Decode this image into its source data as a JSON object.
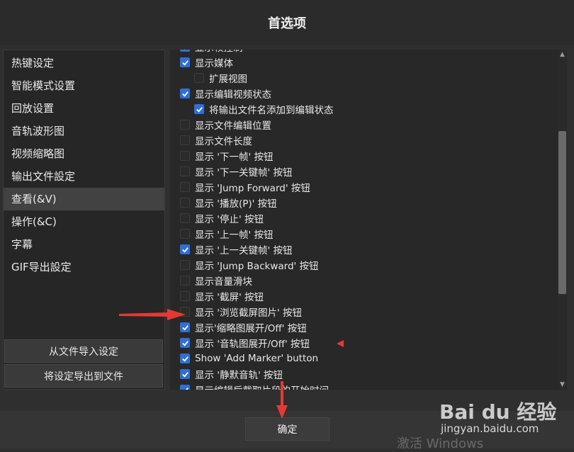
{
  "dialog": {
    "title": "首选项",
    "ok_label": "确定"
  },
  "nav": [
    {
      "label": "热键设定",
      "selected": false
    },
    {
      "label": "智能模式设置",
      "selected": false
    },
    {
      "label": "回放设置",
      "selected": false
    },
    {
      "label": "音轨波形图",
      "selected": false
    },
    {
      "label": "视频缩略图",
      "selected": false
    },
    {
      "label": "输出文件設定",
      "selected": false
    },
    {
      "label": "查看(&V)",
      "selected": true
    },
    {
      "label": "操作(&C)",
      "selected": false
    },
    {
      "label": "字幕",
      "selected": false
    },
    {
      "label": "GIF导出設定",
      "selected": false
    }
  ],
  "left_buttons": {
    "import": "从文件导入设定",
    "export": "将设定导出到文件"
  },
  "options": [
    {
      "label": "显示帧控制",
      "checked": true,
      "indent": false
    },
    {
      "label": "显示媒体",
      "checked": true,
      "indent": false
    },
    {
      "label": "扩展视图",
      "checked": false,
      "indent": true
    },
    {
      "label": "显示编辑视频状态",
      "checked": true,
      "indent": false
    },
    {
      "label": "将输出文件名添加到编辑状态",
      "checked": true,
      "indent": true
    },
    {
      "label": "显示文件编辑位置",
      "checked": false,
      "indent": false
    },
    {
      "label": "显示文件长度",
      "checked": false,
      "indent": false
    },
    {
      "label": "显示 '下一帧' 按钮",
      "checked": false,
      "indent": false
    },
    {
      "label": "显示 '下一关键帧' 按钮",
      "checked": false,
      "indent": false
    },
    {
      "label": "显示 'Jump Forward' 按钮",
      "checked": false,
      "indent": false
    },
    {
      "label": "显示 '播放(P)' 按钮",
      "checked": false,
      "indent": false
    },
    {
      "label": "显示 '停止' 按钮",
      "checked": false,
      "indent": false
    },
    {
      "label": "显示 '上一帧' 按钮",
      "checked": false,
      "indent": false
    },
    {
      "label": "显示 '上一关键帧' 按钮",
      "checked": true,
      "indent": false
    },
    {
      "label": "显示 'Jump Backward' 按钮",
      "checked": false,
      "indent": false
    },
    {
      "label": "显示音量滑块",
      "checked": false,
      "indent": false
    },
    {
      "label": "显示 '截屏' 按钮",
      "checked": false,
      "indent": false
    },
    {
      "label": "显示 '浏览截屏图片' 按钮",
      "checked": false,
      "indent": false
    },
    {
      "label": "显示'缩略图展开/Off' 按钮",
      "checked": true,
      "indent": false
    },
    {
      "label": "显示 '音轨图展开/Off' 按钮",
      "checked": true,
      "indent": false
    },
    {
      "label": "Show 'Add Marker' button",
      "checked": true,
      "indent": false
    },
    {
      "label": "显示 '静默音轨' 按钮",
      "checked": true,
      "indent": false
    },
    {
      "label": "显示编辑后截取片段的开始时间",
      "checked": true,
      "indent": false
    }
  ],
  "watermark": {
    "logo": "Bai du 经验",
    "site": "jingyan.baidu.com",
    "os": "激活 Windows"
  },
  "colors": {
    "accent": "#2f6fd6",
    "annotation": "#e53935"
  }
}
